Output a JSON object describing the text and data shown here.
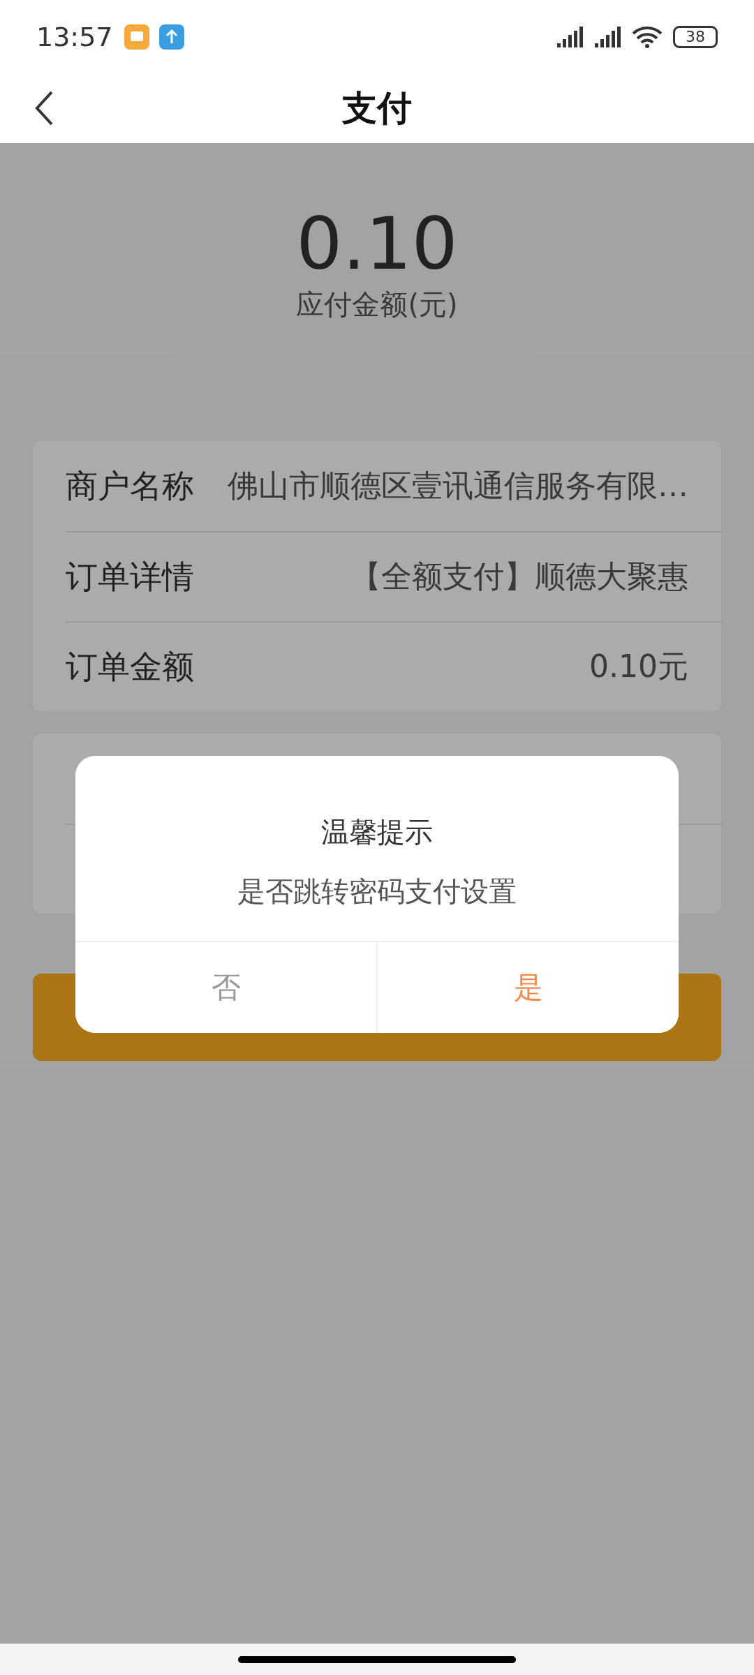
{
  "status_bar": {
    "time": "13:57",
    "battery": "38"
  },
  "header": {
    "title": "支付"
  },
  "amount": {
    "value": "0.10",
    "label": "应付金额(元)"
  },
  "order_card": {
    "rows": [
      {
        "label": "商户名称",
        "value": "佛山市顺德区壹讯通信服务有限…"
      },
      {
        "label": "订单详情",
        "value": "【全额支付】顺德大聚惠"
      },
      {
        "label": "订单金额",
        "value": "0.10元"
      }
    ]
  },
  "dialog": {
    "title": "温馨提示",
    "message": "是否跳转密码支付设置",
    "buttons": [
      {
        "label": "否",
        "kind": "cancel"
      },
      {
        "label": "是",
        "kind": "confirm"
      }
    ]
  }
}
